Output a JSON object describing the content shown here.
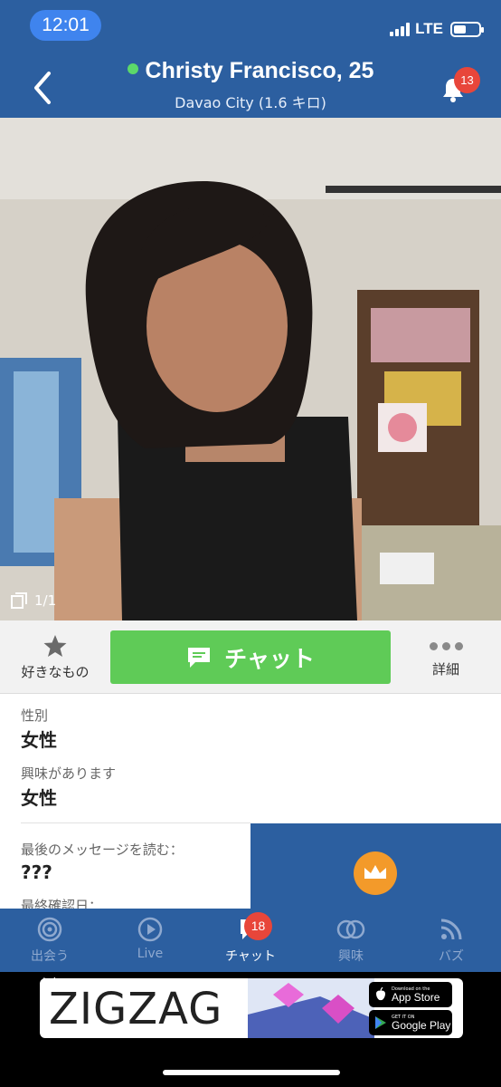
{
  "status_bar": {
    "time": "12:01",
    "network": "LTE",
    "battery_level": 0.5
  },
  "header": {
    "name": "Christy Francisco, 25",
    "location": "Davao City (1.6 キロ)",
    "notification_count": "13",
    "online_color": "#5cd86a",
    "icons": [
      "back-arrow-icon",
      "bell-icon"
    ]
  },
  "photo": {
    "counter": "1/1",
    "icon": "photo-stack-icon"
  },
  "actions": {
    "favorite_label": "好きなもの",
    "chat_label": "チャット",
    "more_label": "詳細",
    "chat_color": "#5fcb57"
  },
  "profile": {
    "gender_label": "性別",
    "gender_value": "女性",
    "interest_label": "興味があります",
    "interest_value": "女性",
    "last_message_label": "最後のメッセージを読む：",
    "last_message_value": "???",
    "last_seen_label": "最終確認日："
  },
  "bottom_nav": {
    "items": [
      {
        "label": "出会う",
        "icon": "target-icon"
      },
      {
        "label": "Live",
        "icon": "play-icon"
      },
      {
        "label": "チャット",
        "icon": "chat-icon"
      },
      {
        "label": "興味",
        "icon": "rings-icon"
      },
      {
        "label": "バズ",
        "icon": "rss-icon"
      }
    ],
    "active": "チャット",
    "chat_badge": "18",
    "accent": "#2c5fa0"
  },
  "ad": {
    "label": "Ad",
    "brand": "ZIGZAG",
    "app_store_small": "Download on the",
    "app_store_big": "App Store",
    "play_small": "GET IT ON",
    "play_big": "Google Play"
  }
}
